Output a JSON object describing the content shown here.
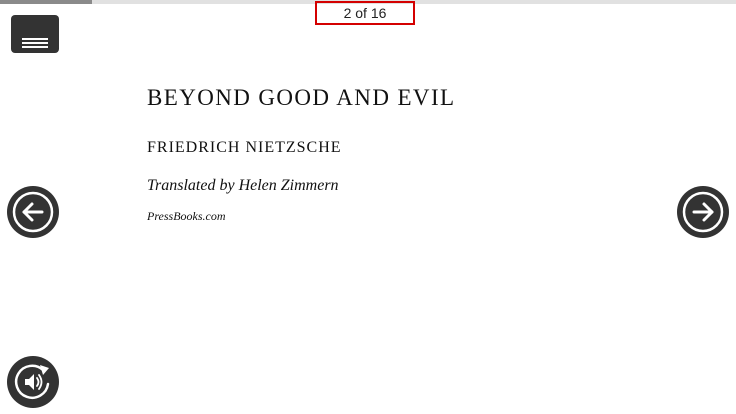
{
  "reader": {
    "progress_fraction": 0.125,
    "page_indicator": "2 of 16"
  },
  "controls": {
    "menu_icon": "hamburger-icon",
    "prev_icon": "arrow-left-icon",
    "next_icon": "arrow-right-icon",
    "audio_icon": "audio-replay-icon"
  },
  "book": {
    "title": "BEYOND GOOD AND EVIL",
    "author": "FRIEDRICH NIETZSCHE",
    "translator": "Translated by Helen Zimmern",
    "publisher": "PressBooks.com"
  },
  "colors": {
    "control_background": "#333333",
    "indicator_border": "#d40000",
    "progress_fill": "#8a8a8a",
    "progress_track": "#e1e1e1"
  }
}
